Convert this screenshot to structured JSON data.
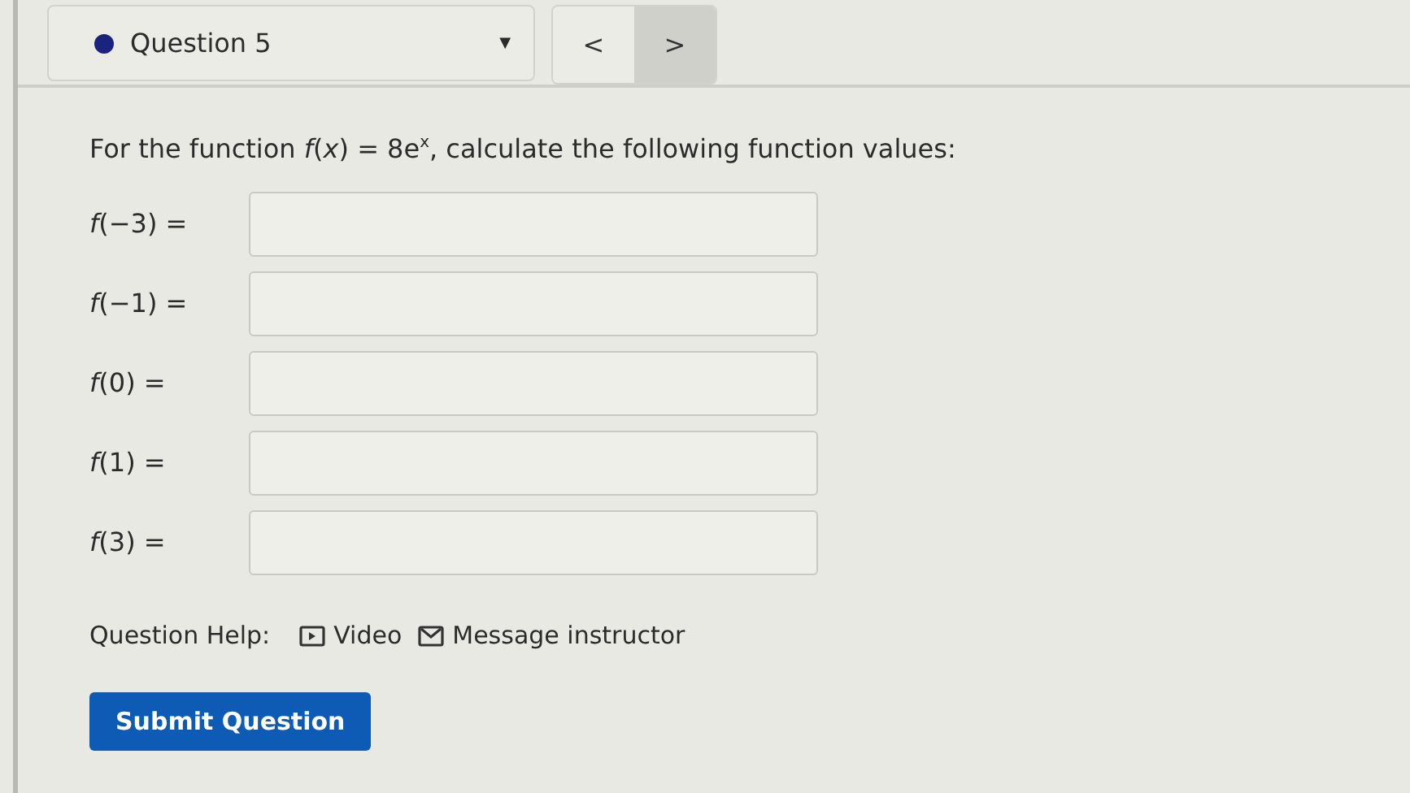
{
  "question_select": {
    "label": "Question 5",
    "caret": "▼"
  },
  "nav_buttons": [
    {
      "label": "<",
      "highlighted": false
    },
    {
      "label": ">",
      "highlighted": true
    }
  ],
  "prompt": "For the function *f*(*x*) = 8e$^{x}$, calculate the following function values:",
  "answers": [
    {
      "label": "*f*(−3) ="
    },
    {
      "label": "*f*(−1) ="
    },
    {
      "label": "*f*(0) ="
    },
    {
      "label": "*f*(1) ="
    },
    {
      "label": "*f*(3) ="
    }
  ],
  "help": {
    "label": "Question Help:",
    "links": [
      {
        "kind": "video",
        "label": "Video"
      },
      {
        "kind": "message",
        "label": "Message instructor"
      }
    ]
  },
  "submit": "Submit Question"
}
